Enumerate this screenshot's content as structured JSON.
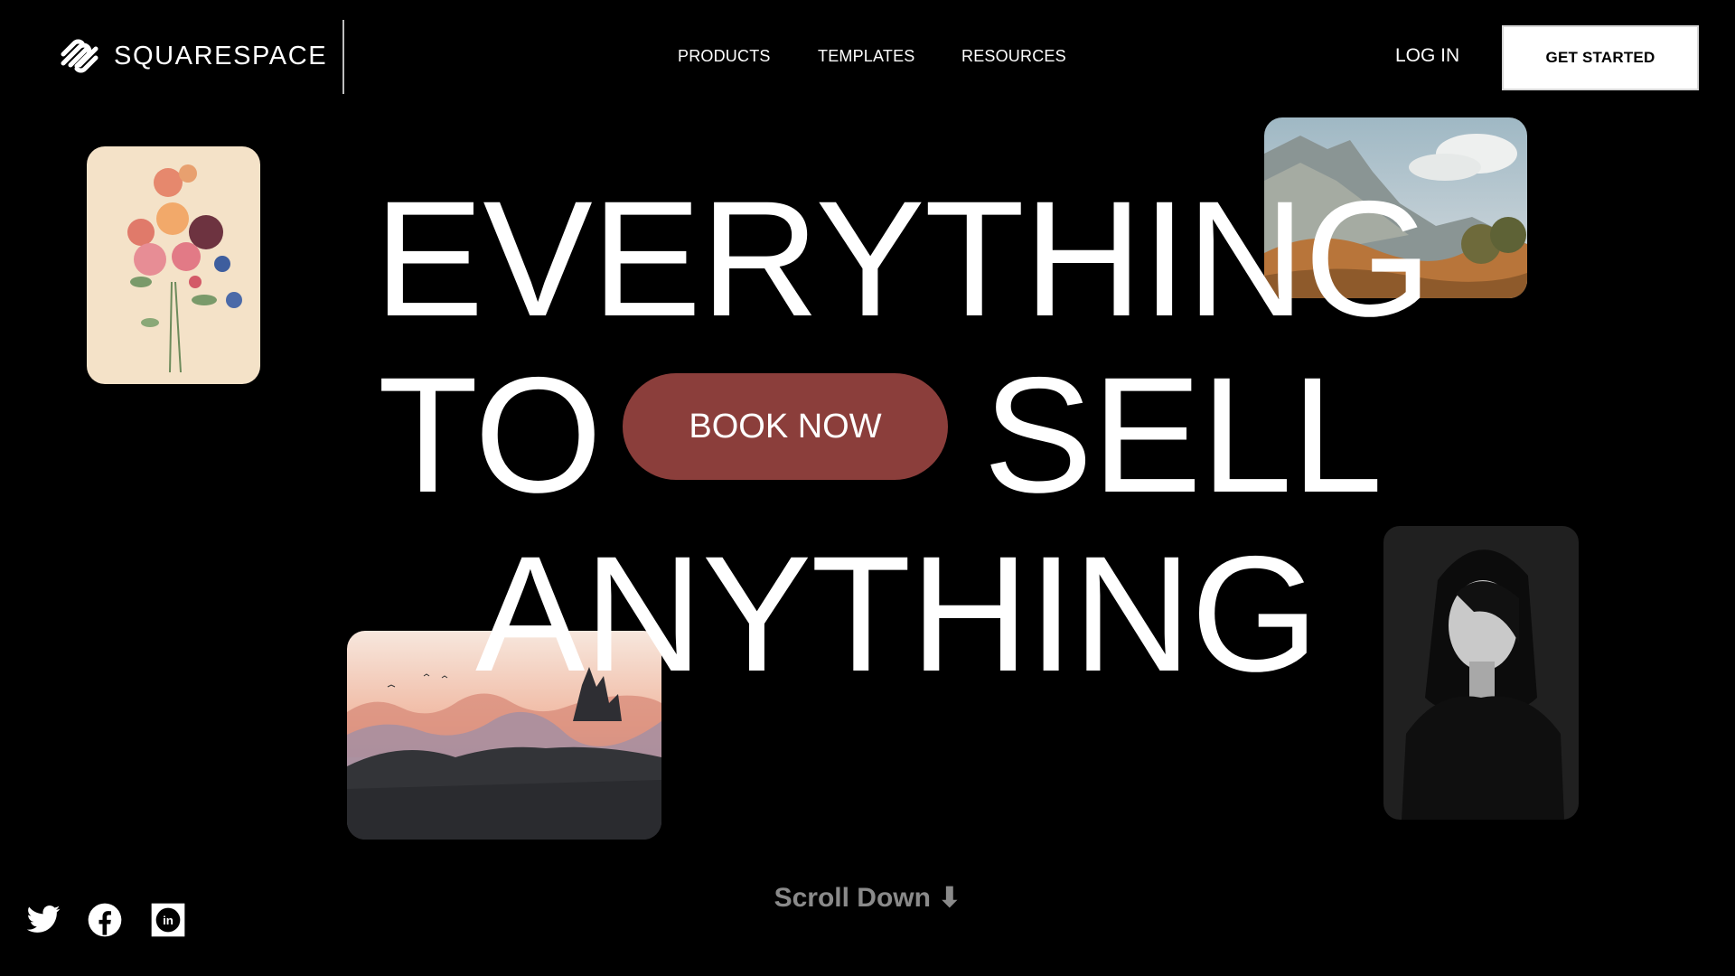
{
  "brand": {
    "name": "SQUARESPACE",
    "logo_icon": "squarespace-logo-icon"
  },
  "nav": {
    "items": [
      {
        "label": "PRODUCTS"
      },
      {
        "label": "TEMPLATES"
      },
      {
        "label": "RESOURCES"
      }
    ],
    "login_label": "LOG IN",
    "get_started_label": "GET STARTED"
  },
  "hero": {
    "line1": "EVERYTHING",
    "line2_left": "TO",
    "line2_right": "SELL",
    "line3": "ANYTHING",
    "cta_label": "BOOK NOW",
    "cta_color": "#8b3e3b"
  },
  "images": [
    {
      "name": "botanical-flowers-image"
    },
    {
      "name": "mountain-landscape-painting-image"
    },
    {
      "name": "misty-forest-sunset-image"
    },
    {
      "name": "woman-portrait-image"
    }
  ],
  "footer": {
    "scroll_label": "Scroll Down ⬇",
    "social": [
      {
        "icon": "twitter-icon"
      },
      {
        "icon": "facebook-icon"
      },
      {
        "icon": "linkedin-icon"
      }
    ]
  }
}
